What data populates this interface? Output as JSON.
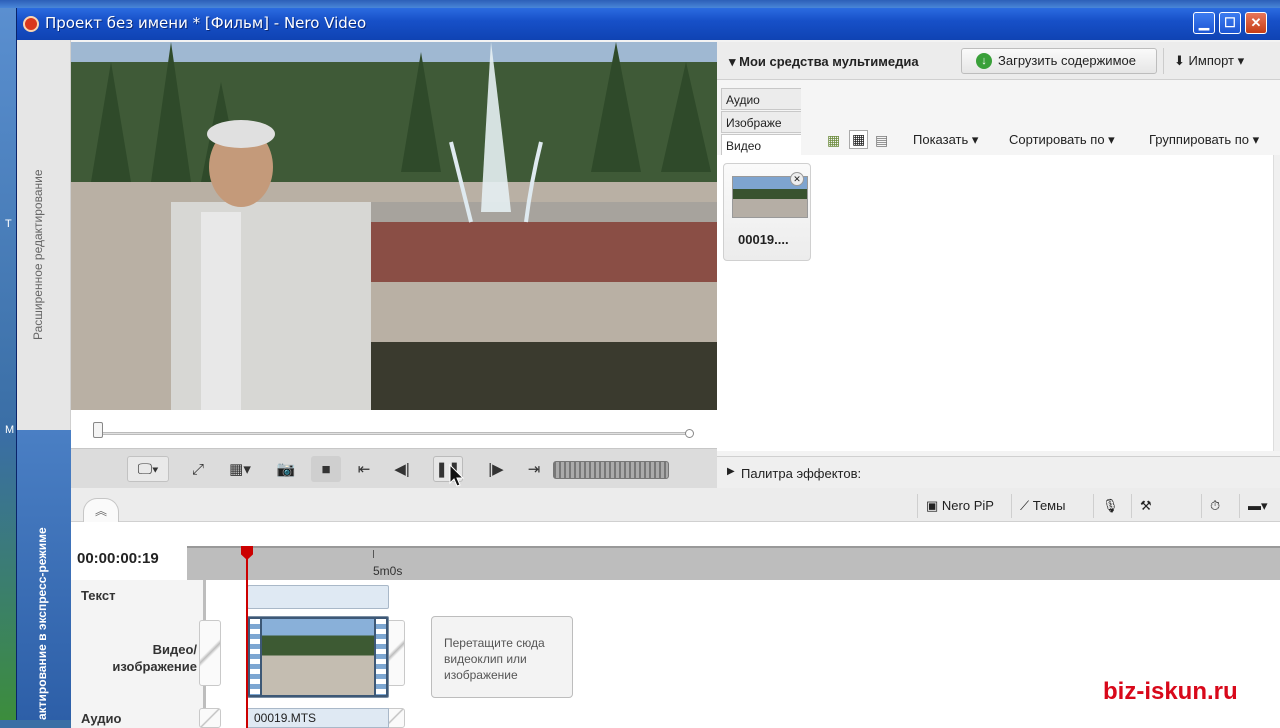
{
  "window": {
    "title": "Проект без имени * [Фильм] - Nero Video"
  },
  "side": {
    "advanced_label": "Расширенное редактирование",
    "express_label": "актирование в экспресс-режиме"
  },
  "media": {
    "title": "Мои средства мультимедиа",
    "load_button": "Загрузить содержимое",
    "import_button": "Импорт",
    "tabs": [
      "Аудио",
      "Изображе",
      "Видео"
    ],
    "options": {
      "show": "Показать",
      "sort": "Сортировать по",
      "group": "Группировать по"
    },
    "items": [
      {
        "label": "00019...."
      }
    ]
  },
  "effects": {
    "title": "Палитра эффектов:"
  },
  "timeline": {
    "timecode": "00:00:00:19",
    "ruler_label": "5m0s",
    "tools": {
      "pip": "Nero PiP",
      "themes": "Темы"
    },
    "tracks": {
      "text": "Текст",
      "video_line1": "Видео/",
      "video_line2": "изображение",
      "audio": "Аудио"
    },
    "drop_hint": "Перетащите сюда видеоклип или изображение",
    "audio_clip": "00019.MTS"
  },
  "watermark": "biz-iskun.ru",
  "icons": {
    "app": "nero-app-icon",
    "minimize": "minimize-icon",
    "maximize": "maximize-icon",
    "close": "close-icon",
    "load": "download-arrow-icon",
    "import": "import-arrow-icon"
  }
}
